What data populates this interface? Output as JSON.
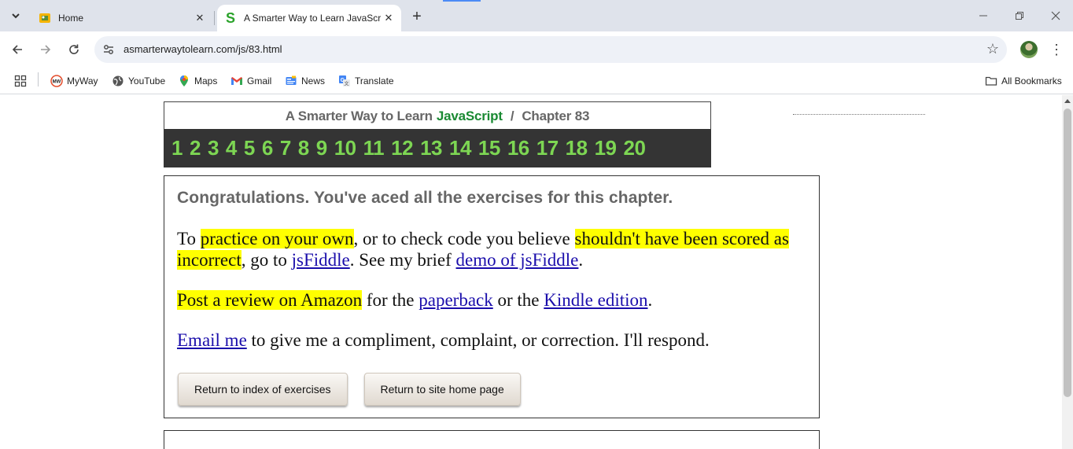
{
  "browser": {
    "tabs": [
      {
        "title": "Home",
        "active": false
      },
      {
        "title": "A Smarter Way to Learn JavaScr",
        "active": true
      }
    ],
    "url": "asmarterwaytolearn.com/js/83.html",
    "bookmarks": [
      {
        "label": "MyWay",
        "icon": "myway-icon"
      },
      {
        "label": "YouTube",
        "icon": "youtube-icon"
      },
      {
        "label": "Maps",
        "icon": "maps-icon"
      },
      {
        "label": "Gmail",
        "icon": "gmail-icon"
      },
      {
        "label": "News",
        "icon": "news-icon"
      },
      {
        "label": "Translate",
        "icon": "translate-icon"
      }
    ],
    "all_bookmarks": "All Bookmarks"
  },
  "header": {
    "title_prefix": "A Smarter Way to Learn",
    "title_language": "JavaScript",
    "title_separator": "/",
    "chapter_label": "Chapter 83",
    "chapters": [
      "1",
      "2",
      "3",
      "4",
      "5",
      "6",
      "7",
      "8",
      "9",
      "10",
      "11",
      "12",
      "13",
      "14",
      "15",
      "16",
      "17",
      "18",
      "19",
      "20"
    ]
  },
  "congrats": {
    "heading": "Congratulations. You've aced all the exercises for this chapter.",
    "p1": {
      "t1": "To ",
      "h1": "practice on your own",
      "t2": ", or to check code you believe ",
      "h2": "shouldn't have been scored as incorrect",
      "t3": ", go to ",
      "link1": "jsFiddle",
      "t4": ". See my brief ",
      "link2": "demo of jsFiddle",
      "t5": "."
    },
    "p2": {
      "h1": "Post a review on Amazon",
      "t1": " for the ",
      "link1": "paperback",
      "t2": " or the ",
      "link2": "Kindle edition",
      "t3": "."
    },
    "p3": {
      "link1": "Email me",
      "t1": " to give me a compliment, complaint, or correction. I'll respond."
    },
    "buttons": {
      "index": "Return to index of exercises",
      "home": "Return to site home page"
    }
  },
  "colors": {
    "highlight": "#ffff00",
    "link": "#1a0dab",
    "chapter_number": "#7dd653",
    "javascript_green": "#1a8a33"
  }
}
